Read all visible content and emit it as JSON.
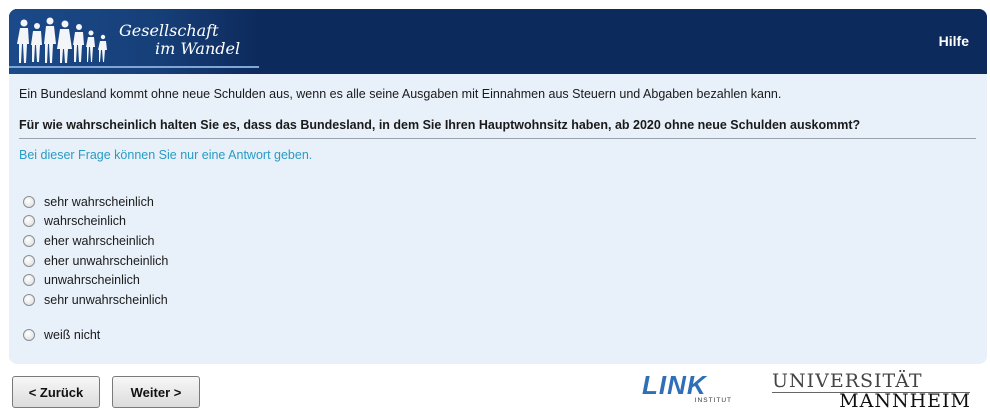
{
  "header": {
    "logo_line1": "Gesellschaft",
    "logo_line2": "im Wandel",
    "help_label": "Hilfe"
  },
  "survey": {
    "intro": "Ein Bundesland kommt ohne neue Schulden aus, wenn es alle seine Ausgaben mit Einnahmen aus Steuern und Abgaben bezahlen kann.",
    "question": "Für wie wahrscheinlich halten Sie es, dass das Bundesland, in dem Sie Ihren Hauptwohnsitz haben, ab 2020 ohne neue Schulden auskommt?",
    "hint": "Bei dieser Frage können Sie nur eine Antwort geben.",
    "options": [
      "sehr wahrscheinlich",
      "wahrscheinlich",
      "eher wahrscheinlich",
      "eher unwahrscheinlich",
      "unwahrscheinlich",
      "sehr unwahrscheinlich"
    ],
    "extra_option": "weiß nicht"
  },
  "nav": {
    "back_label": "< Zurück",
    "next_label": "Weiter >"
  },
  "footer": {
    "link_word": "LINK",
    "link_sub": "INSTITUT",
    "uni_top": "UNIVERSITÄT",
    "uni_bottom": "MANNHEIM"
  },
  "colors": {
    "header_bg": "#0d2a5c",
    "panel_bg": "#e8f0f9",
    "hint_text": "#2a9bc4",
    "link_blue": "#2e6fb7"
  }
}
